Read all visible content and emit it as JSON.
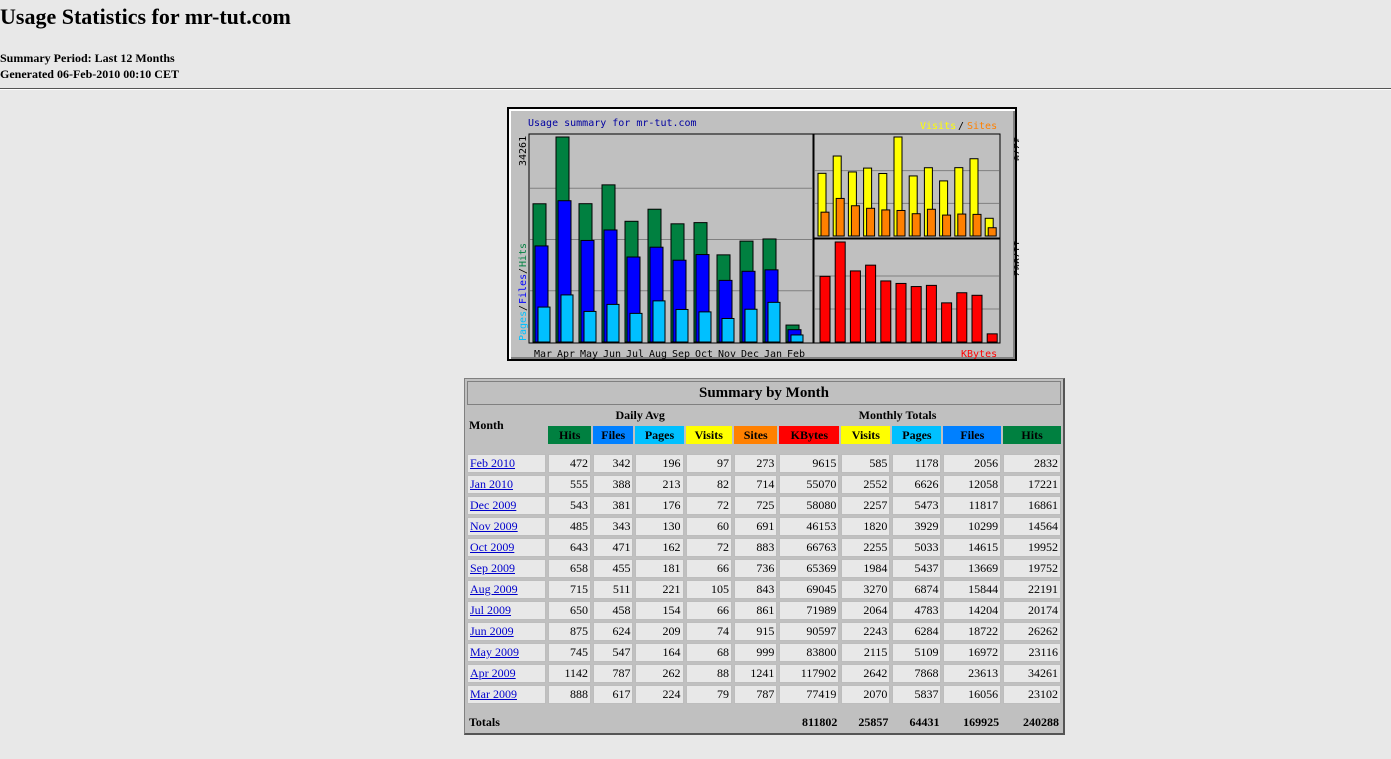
{
  "header": {
    "title": "Usage Statistics for mr-tut.com",
    "period": "Summary Period: Last 12 Months",
    "generated": "Generated 06-Feb-2010 00:10 CET"
  },
  "graph": {
    "title": "Usage summary for mr-tut.com",
    "legend_visits": "Visits",
    "legend_slash": "/",
    "legend_sites": "Sites",
    "left_axis_max": "34261",
    "left_axis_label_pages": "Pages",
    "left_axis_label_files": "Files",
    "left_axis_label_hits": "Hits",
    "right_top_max": "3270",
    "right_bottom_max": "117902",
    "kbytes_label": "KBytes",
    "colors": {
      "hits": "#008040",
      "files": "#0000ff",
      "pages": "#00c0ff",
      "visits": "#ffff00",
      "sites": "#ff8000",
      "kbytes": "#ff0000",
      "title": "#0000a0"
    }
  },
  "chart_data": {
    "type": "bar",
    "title": "Usage summary for mr-tut.com",
    "categories": [
      "Mar",
      "Apr",
      "May",
      "Jun",
      "Jul",
      "Aug",
      "Sep",
      "Oct",
      "Nov",
      "Dec",
      "Jan",
      "Feb"
    ],
    "series": [
      {
        "name": "Hits",
        "values": [
          23102,
          34261,
          23116,
          26262,
          20174,
          22191,
          19752,
          19952,
          14564,
          16861,
          17221,
          2832
        ]
      },
      {
        "name": "Files",
        "values": [
          16056,
          23613,
          16972,
          18722,
          14204,
          15844,
          13669,
          14615,
          10299,
          11817,
          12058,
          2056
        ]
      },
      {
        "name": "Pages",
        "values": [
          5837,
          7868,
          5109,
          6284,
          4783,
          6874,
          5437,
          5033,
          3929,
          5473,
          6626,
          1178
        ]
      },
      {
        "name": "Visits",
        "values": [
          2070,
          2642,
          2115,
          2243,
          2064,
          3270,
          1984,
          2255,
          1820,
          2257,
          2552,
          585
        ]
      },
      {
        "name": "Sites",
        "values": [
          787,
          1241,
          999,
          915,
          861,
          843,
          736,
          883,
          691,
          725,
          714,
          273
        ]
      },
      {
        "name": "KBytes",
        "values": [
          77419,
          117902,
          83800,
          90597,
          71989,
          69045,
          65369,
          66763,
          46153,
          58080,
          55070,
          9615
        ]
      }
    ]
  },
  "table": {
    "caption": "Summary by Month",
    "month_header": "Month",
    "daily_avg_header": "Daily Avg",
    "monthly_totals_header": "Monthly Totals",
    "columns": {
      "d_hits": "Hits",
      "d_files": "Files",
      "d_pages": "Pages",
      "d_visits": "Visits",
      "m_sites": "Sites",
      "m_kbytes": "KBytes",
      "m_visits": "Visits",
      "m_pages": "Pages",
      "m_files": "Files",
      "m_hits": "Hits"
    },
    "rows": [
      {
        "month": "Feb 2010",
        "d_hits": "472",
        "d_files": "342",
        "d_pages": "196",
        "d_visits": "97",
        "m_sites": "273",
        "m_kbytes": "9615",
        "m_visits": "585",
        "m_pages": "1178",
        "m_files": "2056",
        "m_hits": "2832"
      },
      {
        "month": "Jan 2010",
        "d_hits": "555",
        "d_files": "388",
        "d_pages": "213",
        "d_visits": "82",
        "m_sites": "714",
        "m_kbytes": "55070",
        "m_visits": "2552",
        "m_pages": "6626",
        "m_files": "12058",
        "m_hits": "17221"
      },
      {
        "month": "Dec 2009",
        "d_hits": "543",
        "d_files": "381",
        "d_pages": "176",
        "d_visits": "72",
        "m_sites": "725",
        "m_kbytes": "58080",
        "m_visits": "2257",
        "m_pages": "5473",
        "m_files": "11817",
        "m_hits": "16861"
      },
      {
        "month": "Nov 2009",
        "d_hits": "485",
        "d_files": "343",
        "d_pages": "130",
        "d_visits": "60",
        "m_sites": "691",
        "m_kbytes": "46153",
        "m_visits": "1820",
        "m_pages": "3929",
        "m_files": "10299",
        "m_hits": "14564"
      },
      {
        "month": "Oct 2009",
        "d_hits": "643",
        "d_files": "471",
        "d_pages": "162",
        "d_visits": "72",
        "m_sites": "883",
        "m_kbytes": "66763",
        "m_visits": "2255",
        "m_pages": "5033",
        "m_files": "14615",
        "m_hits": "19952"
      },
      {
        "month": "Sep 2009",
        "d_hits": "658",
        "d_files": "455",
        "d_pages": "181",
        "d_visits": "66",
        "m_sites": "736",
        "m_kbytes": "65369",
        "m_visits": "1984",
        "m_pages": "5437",
        "m_files": "13669",
        "m_hits": "19752"
      },
      {
        "month": "Aug 2009",
        "d_hits": "715",
        "d_files": "511",
        "d_pages": "221",
        "d_visits": "105",
        "m_sites": "843",
        "m_kbytes": "69045",
        "m_visits": "3270",
        "m_pages": "6874",
        "m_files": "15844",
        "m_hits": "22191"
      },
      {
        "month": "Jul 2009",
        "d_hits": "650",
        "d_files": "458",
        "d_pages": "154",
        "d_visits": "66",
        "m_sites": "861",
        "m_kbytes": "71989",
        "m_visits": "2064",
        "m_pages": "4783",
        "m_files": "14204",
        "m_hits": "20174"
      },
      {
        "month": "Jun 2009",
        "d_hits": "875",
        "d_files": "624",
        "d_pages": "209",
        "d_visits": "74",
        "m_sites": "915",
        "m_kbytes": "90597",
        "m_visits": "2243",
        "m_pages": "6284",
        "m_files": "18722",
        "m_hits": "26262"
      },
      {
        "month": "May 2009",
        "d_hits": "745",
        "d_files": "547",
        "d_pages": "164",
        "d_visits": "68",
        "m_sites": "999",
        "m_kbytes": "83800",
        "m_visits": "2115",
        "m_pages": "5109",
        "m_files": "16972",
        "m_hits": "23116"
      },
      {
        "month": "Apr 2009",
        "d_hits": "1142",
        "d_files": "787",
        "d_pages": "262",
        "d_visits": "88",
        "m_sites": "1241",
        "m_kbytes": "117902",
        "m_visits": "2642",
        "m_pages": "7868",
        "m_files": "23613",
        "m_hits": "34261"
      },
      {
        "month": "Mar 2009",
        "d_hits": "888",
        "d_files": "617",
        "d_pages": "224",
        "d_visits": "79",
        "m_sites": "787",
        "m_kbytes": "77419",
        "m_visits": "2070",
        "m_pages": "5837",
        "m_files": "16056",
        "m_hits": "23102"
      }
    ],
    "totals": {
      "label": "Totals",
      "kbytes": "811802",
      "visits": "25857",
      "pages": "64431",
      "files": "169925",
      "hits": "240288"
    }
  }
}
